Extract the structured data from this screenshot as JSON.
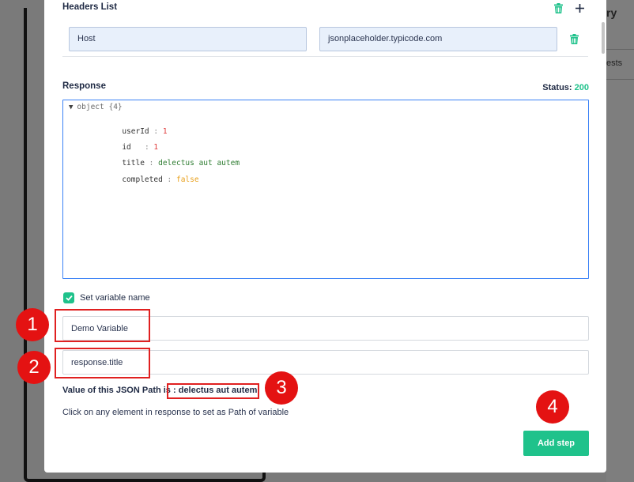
{
  "background": {
    "title_fragment": "ry",
    "tab_fragment": "ests"
  },
  "headers": {
    "title": "Headers List",
    "delete_all_icon": "trash-icon",
    "add_icon": "plus-icon",
    "rows": [
      {
        "key": "Host",
        "value": "jsonplaceholder.typicode.com"
      }
    ]
  },
  "response": {
    "title": "Response",
    "status_label": "Status:",
    "status_value": "200",
    "root_label": "object",
    "root_count": "{4}",
    "fields": [
      {
        "key": "userId",
        "value": "1",
        "type": "number"
      },
      {
        "key": "id",
        "value": "1",
        "type": "number"
      },
      {
        "key": "title",
        "value": "delectus aut autem",
        "type": "string"
      },
      {
        "key": "completed",
        "value": "false",
        "type": "boolean"
      }
    ]
  },
  "variable": {
    "checkbox_label": "Set variable name",
    "checked": true,
    "name_value": "Demo Variable",
    "path_value": "response.title"
  },
  "jsonpath": {
    "label": "Value of this JSON Path is :",
    "value": "delectus aut autem"
  },
  "hint": "Click on any element in response to set as Path of variable",
  "add_step_label": "Add step",
  "annotations": [
    "1",
    "2",
    "3",
    "4"
  ],
  "colors": {
    "accent": "#1fc28b",
    "annotation": "#e41212",
    "response_border": "#3b82f6"
  }
}
